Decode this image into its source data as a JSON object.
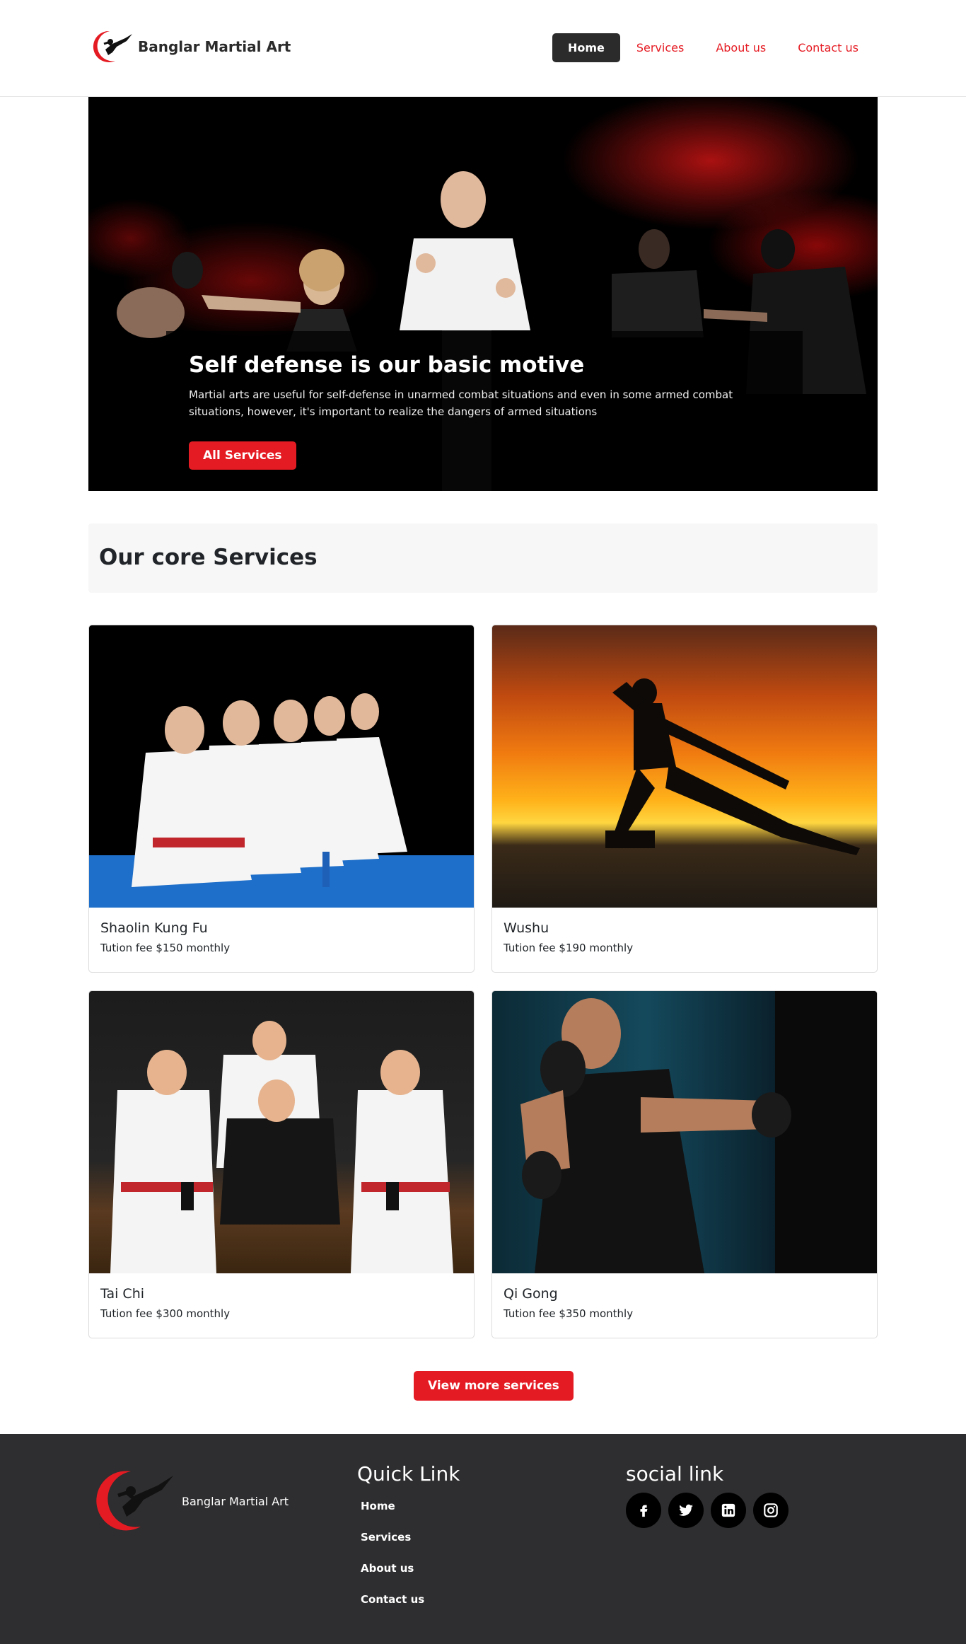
{
  "brand": {
    "name": "Banglar Martial Art",
    "logo_icon": "martial-artist-kick-logo",
    "accent_color": "#e51b23",
    "dark_color": "#2b2b2b"
  },
  "nav": {
    "items": [
      {
        "label": "Home",
        "active": true
      },
      {
        "label": "Services",
        "active": false
      },
      {
        "label": "About us",
        "active": false
      },
      {
        "label": "Contact us",
        "active": false
      }
    ]
  },
  "hero": {
    "title": "Self defense is our basic motive",
    "description": "Martial arts are useful for self-defense in unarmed combat situations and even in some armed combat situations, however, it's important to realize the dangers of armed situations",
    "button_label": "All Services"
  },
  "services_section": {
    "title": "Our core Services",
    "cards": [
      {
        "title": "Shaolin Kung Fu",
        "fee": "Tution fee $150 monthly",
        "image": "kneeling-students-in-white-gi"
      },
      {
        "title": "Wushu",
        "fee": "Tution fee $190 monthly",
        "image": "silhouette-fighter-at-sunset"
      },
      {
        "title": "Tai Chi",
        "fee": "Tution fee $300 monthly",
        "image": "group-of-instructors-in-gi"
      },
      {
        "title": "Qi Gong",
        "fee": "Tution fee $350 monthly",
        "image": "boxer-hitting-punching-bag"
      }
    ],
    "more_button_label": "View more services"
  },
  "footer": {
    "brand_name": "Banglar Martial Art",
    "quick_link_title": "Quick Link",
    "quick_links": [
      "Home",
      "Services",
      "About us",
      "Contact us"
    ],
    "social_title": "social link",
    "social_icons": [
      "facebook-icon",
      "twitter-icon",
      "linkedin-icon",
      "instagram-icon"
    ],
    "background_color": "#2e2d2f"
  }
}
